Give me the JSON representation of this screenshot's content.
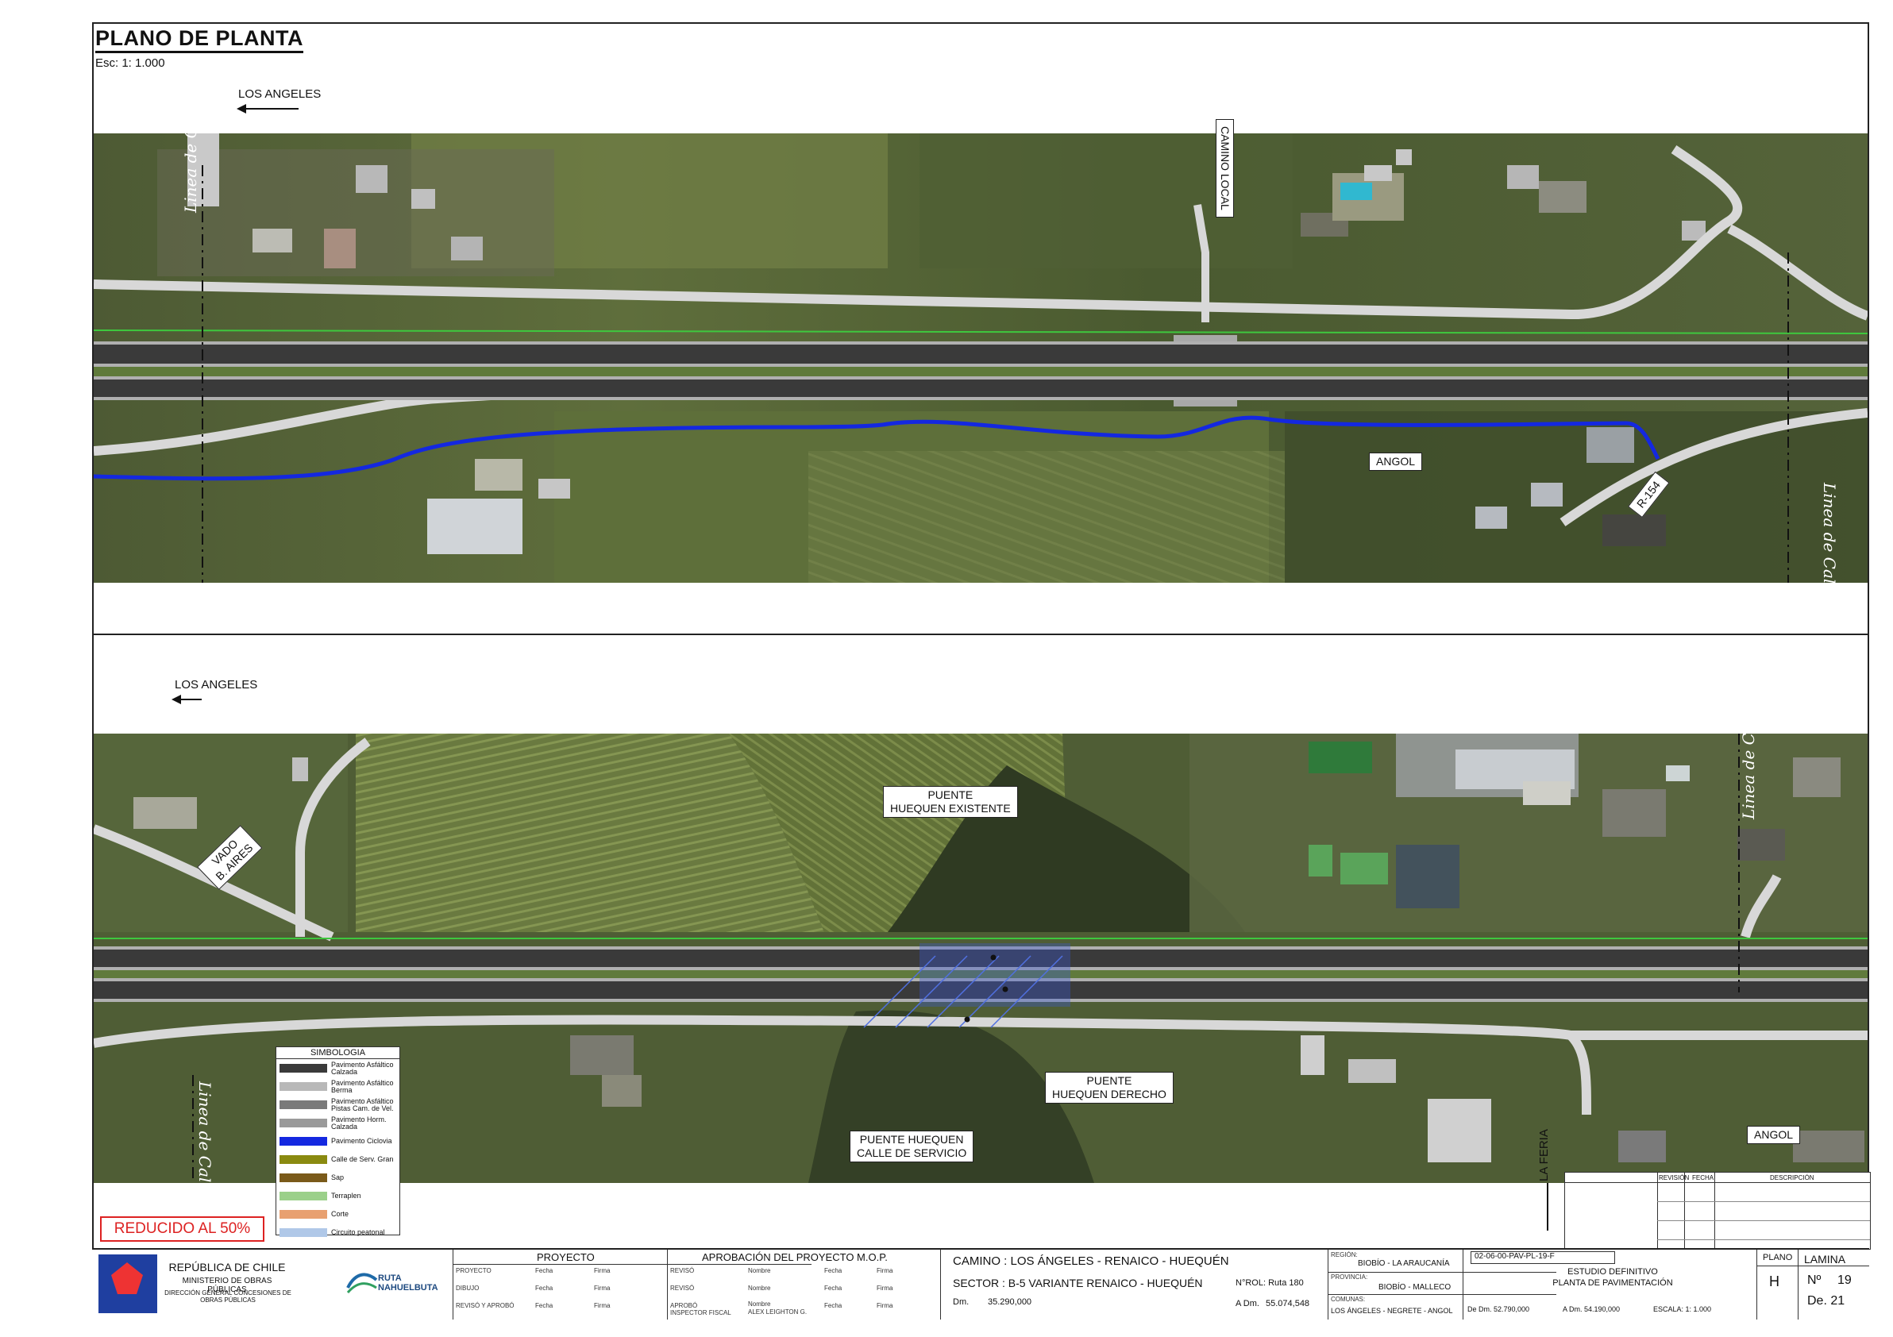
{
  "header": {
    "title": "PLANO DE PLANTA",
    "scale": "Esc: 1: 1.000"
  },
  "top_panel": {
    "dir_left": "LOS ANGELES",
    "camino_local": "CAMINO LOCAL",
    "angol": "ANGOL",
    "r154": "R-154",
    "calce": "Linea de Calce"
  },
  "bottom_panel": {
    "dir_left": "LOS ANGELES",
    "vado_line1": "VADO",
    "vado_line2": "B. AIRES",
    "puente_existente_1": "PUENTE",
    "puente_existente_2": "HUEQUEN EXISTENTE",
    "puente_derecho_1": "PUENTE",
    "puente_derecho_2": "HUEQUEN DERECHO",
    "puente_servicio_1": "PUENTE HUEQUEN",
    "puente_servicio_2": "CALLE DE SERVICIO",
    "la_feria": "LA FERIA",
    "angol": "ANGOL",
    "calce": "Linea de Calce"
  },
  "reducido": "REDUCIDO AL 50%",
  "legend": {
    "title": "SIMBOLOGIA",
    "items": [
      {
        "label": "Pavimento Asfáltico Calzada",
        "color": "#3a3a3a"
      },
      {
        "label": "Pavimento Asfáltico Berma",
        "color": "#b8b8b8"
      },
      {
        "label": "Pavimento Asfáltico Pistas Cam. de Vel.",
        "color": "#7a7a7a"
      },
      {
        "label": "Pavimento Horm. Calzada",
        "color": "#9a9a9a"
      },
      {
        "label": "Pavimento Ciclovia",
        "color": "#1428e0"
      },
      {
        "label": "Calle de Serv. Gran",
        "color": "#8a8a10"
      },
      {
        "label": "Sap",
        "color": "#7a5a1a"
      },
      {
        "label": "Terraplen",
        "color": "#9bd08a"
      },
      {
        "label": "Corte",
        "color": "#e8a070"
      },
      {
        "label": "Circuito peatonal",
        "color": "#b0c8e8"
      }
    ]
  },
  "revision_table": {
    "col1": "REVISIÓN",
    "col2": "FECHA",
    "col3": "DESCRIPCIÓN"
  },
  "titleblock": {
    "country": "REPÚBLICA DE CHILE",
    "ministry": "MINISTERIO DE OBRAS PÚBLICAS",
    "direction": "DIRECCIÓN GENERAL CONCESIONES DE OBRAS PÚBLICAS",
    "brand": "RUTA NAHUELBUTA",
    "proyecto": "PROYECTO",
    "aprobacion": "APROBACIÓN DEL PROYECTO M.O.P.",
    "proj_rows": [
      "PROYECTO",
      "DIBUJO",
      "REVISÓ Y APROBÓ"
    ],
    "mop_rows": [
      "REVISÓ",
      "REVISÓ",
      "APROBÓ INSPECTOR FISCAL"
    ],
    "fecha": "Fecha",
    "firma": "Firma",
    "nombre": "Nombre",
    "inspector_name": "ALEX LEIGHTON G.",
    "camino": "CAMINO : LOS ÁNGELES - RENAICO - HUEQUÉN",
    "sector": "SECTOR : B-5 VARIANTE RENAICO - HUEQUÉN",
    "nrol": "N°ROL: Ruta 180",
    "dm": "Dm.",
    "dm_value": "35.290,000",
    "adm": "A Dm.",
    "adm_value": "55.074,548",
    "region_label": "REGIÓN:",
    "region": "BIOBÍO - LA ARAUCANÍA",
    "provincia_label": "PROVINCIA:",
    "provincia": "BIOBÍO - MALLECO",
    "comunas_label": "COMUNAS:",
    "comunas": "LOS ÁNGELES - NEGRETE - ANGOL",
    "code": "02-06-00-PAV-PL-19-F",
    "estudio": "ESTUDIO DEFINITIVO",
    "planta": "PLANTA DE PAVIMENTACIÓN",
    "de_dm": "De Dm. 52.790,000",
    "a_dm": "A Dm. 54.190,000",
    "escala": "ESCALA: 1: 1.000",
    "plano_label": "PLANO",
    "plano_value": "H",
    "lamina_label": "LAMINA",
    "lamina_no": "Nº",
    "lamina_value": "19",
    "lamina_total": "De. 21"
  }
}
